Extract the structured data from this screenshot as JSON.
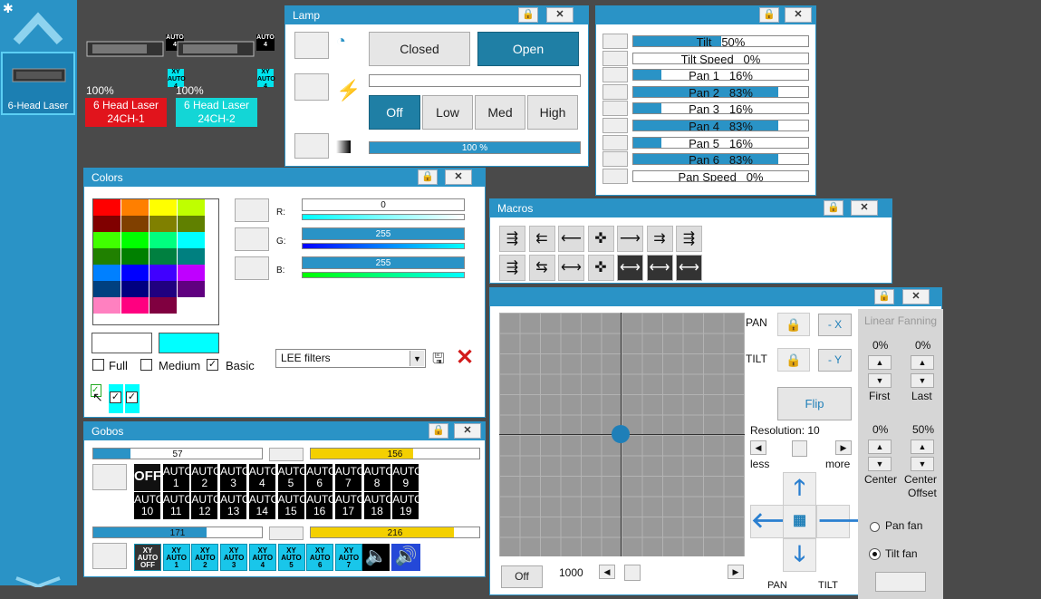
{
  "sidebar": {
    "fixture_label": "6-Head Laser"
  },
  "fixtures": [
    {
      "percent": "100%",
      "name_line1": "6 Head Laser",
      "name_line2": "24CH-1",
      "color": "#e1141c"
    },
    {
      "percent": "100%",
      "name_line1": "6 Head Laser",
      "name_line2": "24CH-2",
      "color": "#13d6d6"
    }
  ],
  "auto_tag": {
    "line1": "AUTO",
    "line2": "4",
    "xy": "XY\nAUTO\n4"
  },
  "lamp": {
    "title": "Lamp",
    "closed": "Closed",
    "open": "Open",
    "off": "Off",
    "low": "Low",
    "med": "Med",
    "high": "High",
    "dimmer": "100 %",
    "dimmer_fraction": 1.0
  },
  "tilt_panel": {
    "rows": [
      {
        "label": "Tilt",
        "percent": "50%",
        "fraction": 0.5
      },
      {
        "label": "Tilt Speed",
        "percent": "0%",
        "fraction": 0
      },
      {
        "label": "Pan 1",
        "percent": "16%",
        "fraction": 0.16
      },
      {
        "label": "Pan 2",
        "percent": "83%",
        "fraction": 0.83
      },
      {
        "label": "Pan 3",
        "percent": "16%",
        "fraction": 0.16
      },
      {
        "label": "Pan 4",
        "percent": "83%",
        "fraction": 0.83
      },
      {
        "label": "Pan 5",
        "percent": "16%",
        "fraction": 0.16
      },
      {
        "label": "Pan 6",
        "percent": "83%",
        "fraction": 0.83
      },
      {
        "label": "Pan Speed",
        "percent": "0%",
        "fraction": 0
      }
    ]
  },
  "colors": {
    "title": "Colors",
    "palette": [
      [
        "#ff0000",
        "#ff7f00",
        "#ffff00",
        "#bfff00"
      ],
      [
        "#800000",
        "#804000",
        "#808000",
        "#608000"
      ],
      [
        "#40ff00",
        "#00ff00",
        "#00ff7f",
        "#00ffff"
      ],
      [
        "#208000",
        "#008000",
        "#008040",
        "#008080"
      ],
      [
        "#0080ff",
        "#0000ff",
        "#4000ff",
        "#bf00ff"
      ],
      [
        "#004080",
        "#000080",
        "#200080",
        "#600080"
      ],
      [
        "#ff80c0",
        "#ff0080",
        "#800040",
        "#ffffff"
      ]
    ],
    "r_label": "R:",
    "g_label": "G:",
    "b_label": "B:",
    "r_value": "0",
    "g_value": "255",
    "b_value": "255",
    "r_fraction": 0,
    "g_fraction": 1,
    "b_fraction": 1,
    "preview_old": "#ffffff",
    "preview_new": "#00ffff",
    "full": "Full",
    "medium": "Medium",
    "basic": "Basic",
    "filter": "LEE filters"
  },
  "macros": {
    "title": "Macros"
  },
  "gobos": {
    "title": "Gobos",
    "bar1": "57",
    "bar1_fraction": 0.22,
    "bar2": "156",
    "bar2_fraction": 0.61,
    "bar3": "171",
    "bar3_fraction": 0.67,
    "bar4": "216",
    "bar4_fraction": 0.85,
    "off": "OFF",
    "auto_word": "AUTO",
    "autos": [
      "1",
      "2",
      "3",
      "4",
      "5",
      "6",
      "7",
      "8",
      "9",
      "10",
      "11",
      "12",
      "13",
      "14",
      "15",
      "16",
      "17",
      "18",
      "19"
    ],
    "xy": [
      "XY\nAUTO\nOFF",
      "XY\nAUTO\n1",
      "XY\nAUTO\n2",
      "XY\nAUTO\n3",
      "XY\nAUTO\n4",
      "XY\nAUTO\n5",
      "XY\nAUTO\n6",
      "XY\nAUTO\n7"
    ]
  },
  "xy_pad": {
    "pan": "PAN",
    "tilt": "TILT",
    "minus_x": "- X",
    "minus_y": "- Y",
    "flip": "Flip",
    "resolution": "Resolution: 10",
    "less": "less",
    "more": "more",
    "off": "Off",
    "speed": "1000",
    "pan_bottom": "PAN",
    "tilt_bottom": "TILT",
    "fanning": "Linear Fanning",
    "first_pct": "0%",
    "last_pct": "0%",
    "first": "First",
    "last": "Last",
    "center_pct": "0%",
    "offset_pct": "50%",
    "center": "Center",
    "center_offset1": "Center",
    "center_offset2": "Offset",
    "pan_fan": "Pan fan",
    "tilt_fan": "Tilt fan"
  }
}
